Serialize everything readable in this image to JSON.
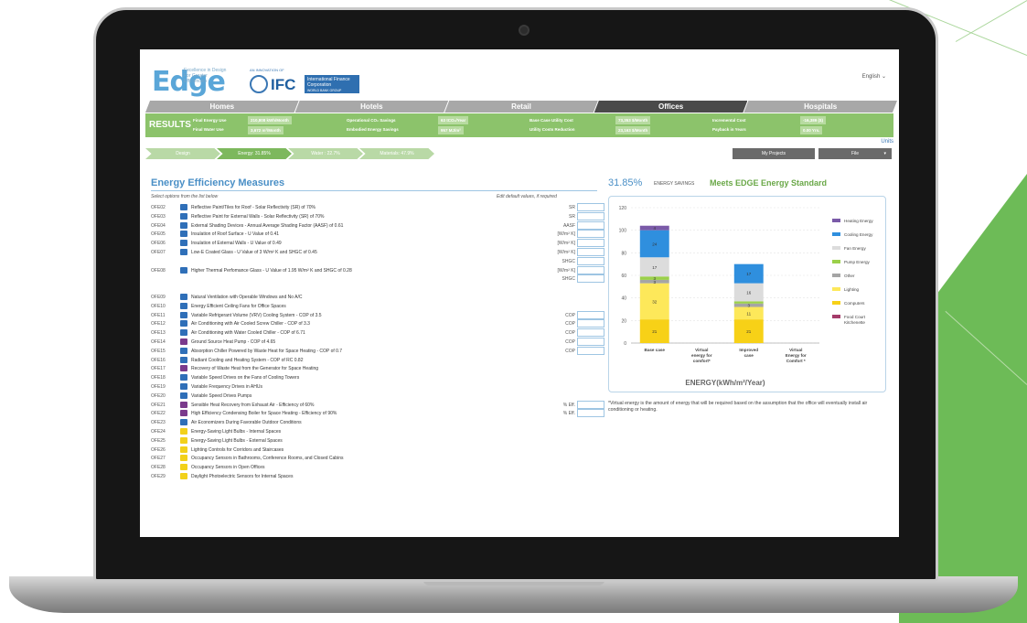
{
  "header": {
    "logo": "Edge",
    "logo_tagline": "Excellence in Design For Greater Efficiencies",
    "ifc_small": "AN INNOVATION OF",
    "ifc_logo": "IFC",
    "ifc_full": "International Finance Corporation",
    "ifc_group": "WORLD BANK GROUP",
    "language": "English"
  },
  "tabs": [
    {
      "label": "Homes",
      "active": false
    },
    {
      "label": "Hotels",
      "active": false
    },
    {
      "label": "Retail",
      "active": false
    },
    {
      "label": "Offices",
      "active": true
    },
    {
      "label": "Hospitals",
      "active": false
    }
  ],
  "results": {
    "title": "RESULTS",
    "final_energy_label": "Final Energy Use",
    "final_energy_value": "210,808 kWh/Month",
    "final_water_label": "Final Water Use",
    "final_water_value": "3,672 m³/Month",
    "op_co2_label": "Operational CO₂ Savings",
    "op_co2_value": "63 tCO₂/Year",
    "embodied_label": "Embodied Energy Savings",
    "embodied_value": "957 MJ/m²",
    "base_cost_label": "Base Case Utility Cost",
    "base_cost_value": "73,353 $/Month",
    "cost_red_label": "Utility Costs Reduction",
    "cost_red_value": "23,163 $/Month",
    "incr_cost_label": "Incremental Cost",
    "incr_cost_value": "-16,389 ($)",
    "payback_label": "Payback in Years",
    "payback_value": "0.00 Yrs."
  },
  "nav": {
    "steps": [
      {
        "label": "Design",
        "active": false
      },
      {
        "label": "Energy: 31.85%",
        "active": true
      },
      {
        "label": "Water : 22.7%",
        "active": false
      },
      {
        "label": "Materials: 47.9%",
        "active": false
      }
    ],
    "units_link": "Units",
    "my_projects": "My Projects",
    "file": "File"
  },
  "measures_panel": {
    "title": "Energy Efficiency Measures",
    "subtitle": "Select options from the list below",
    "edit_hint": "Edit default values, if required",
    "items": [
      {
        "code": "OFE02",
        "text": "Reflective Paint/Tiles for Roof - Solar Reflectivity (SR) of 70%",
        "unit": "SR",
        "color": "#2f6fb8",
        "input": true
      },
      {
        "code": "OFE03",
        "text": "Reflective Paint for External Walls - Solar Reflectivity (SR) of 70%",
        "unit": "SR",
        "color": "#2f6fb8",
        "input": true
      },
      {
        "code": "OFE04",
        "text": "External Shading Devices - Annual Average Shading Factor (AASF) of 0.61",
        "unit": "AASF",
        "color": "#2f6fb8",
        "input": true
      },
      {
        "code": "OFE05",
        "text": "Insulation of Roof Surface - U Value of 0.41",
        "unit": "[W/m² K]",
        "color": "#2f6fb8",
        "input": true
      },
      {
        "code": "OFE06",
        "text": "Insulation of External Walls - U Value of 0.49",
        "unit": "[W/m² K]",
        "color": "#2f6fb8",
        "input": true
      },
      {
        "code": "OFE07",
        "text": "Low-E Coated Glass - U Value of 3 W/m² K and SHGC of 0.45",
        "unit": "[W/m² K]",
        "color": "#2f6fb8",
        "input": true
      },
      {
        "code": "",
        "text": "",
        "unit": "SHGC",
        "color": "",
        "input": true
      },
      {
        "code": "OFE08",
        "text": "Higher Thermal Perfomance Glass - U Value of 1.95 W/m² K and SHGC of 0.28",
        "unit": "[W/m² K]",
        "color": "#2f6fb8",
        "input": true
      },
      {
        "code": "",
        "text": "",
        "unit": "SHGC",
        "color": "",
        "input": true
      },
      {
        "code": "",
        "text": "",
        "unit": "",
        "color": "",
        "input": false
      },
      {
        "code": "OFE09",
        "text": "Natural Ventilation with Operable Windows and No A/C",
        "unit": "",
        "color": "#2f6fb8",
        "input": false
      },
      {
        "code": "OFE10",
        "text": "Energy Efficient Ceiling Fans for Office Spaces",
        "unit": "",
        "color": "#2f6fb8",
        "input": false
      },
      {
        "code": "OFE11",
        "text": "Variable Refrigerant Volume (VRV) Cooling System - COP of 3.5",
        "unit": "COP",
        "color": "#2f6fb8",
        "input": true
      },
      {
        "code": "OFE12",
        "text": "Air Conditioning with Air Cooled Screw Chiller - COP of 3.3",
        "unit": "COP",
        "color": "#2f6fb8",
        "input": true
      },
      {
        "code": "OFE13",
        "text": "Air Conditioning with Water Cooled Chiller - COP of 6.71",
        "unit": "COP",
        "color": "#2f6fb8",
        "input": true
      },
      {
        "code": "OFE14",
        "text": "Ground Source Heat Pump - COP of 4.65",
        "unit": "COP",
        "color": "#7a3a8c",
        "input": true
      },
      {
        "code": "OFE15",
        "text": "Absorption Chiller Powered by Waste Heat for Space Heating - COP of 0.7",
        "unit": "COP",
        "color": "#2f6fb8",
        "input": true
      },
      {
        "code": "OFE16",
        "text": "Radiant Cooling and Heating System - COP of RC 0.82",
        "unit": "",
        "color": "#2f6fb8",
        "input": false
      },
      {
        "code": "OFE17",
        "text": "Recovery of Waste Heat from the Generator for Space Heating",
        "unit": "",
        "color": "#7a3a8c",
        "input": false
      },
      {
        "code": "OFE18",
        "text": "Variable Speed Drives on the Fans of Cooling Towers",
        "unit": "",
        "color": "#2f6fb8",
        "input": false
      },
      {
        "code": "OFE19",
        "text": "Variable Frequency Drives in AHUs",
        "unit": "",
        "color": "#2f6fb8",
        "input": false
      },
      {
        "code": "OFE20",
        "text": "Variable Speed Drives Pumps",
        "unit": "",
        "color": "#2f6fb8",
        "input": false
      },
      {
        "code": "OFE21",
        "text": "Sensible Heat Recovery from Exhaust Air - Efficiency of 60%",
        "unit": "% Eff.",
        "color": "#7a3a8c",
        "input": true
      },
      {
        "code": "OFE22",
        "text": "High Efficiency Condensing Boiler for Space Heating - Efficiency of 90%",
        "unit": "% Eff.",
        "color": "#7a3a8c",
        "input": true
      },
      {
        "code": "OFE23",
        "text": "Air Economizers During Favorable Outdoor Conditions",
        "unit": "",
        "color": "#2f6fb8",
        "input": false
      },
      {
        "code": "OFE24",
        "text": "Energy-Saving Light Bulbs - Internal Spaces",
        "unit": "",
        "color": "#f2d11a",
        "input": false
      },
      {
        "code": "OFE25",
        "text": "Energy-Saving Light Bulbs - External Spaces",
        "unit": "",
        "color": "#f2d11a",
        "input": false
      },
      {
        "code": "OFE26",
        "text": "Lighting Controls for Corridors and Staircases",
        "unit": "",
        "color": "#f2d11a",
        "input": false
      },
      {
        "code": "OFE27",
        "text": "Occupancy Sensors in Bathrooms, Conference Rooms, and Closed Cabins",
        "unit": "",
        "color": "#f2d11a",
        "input": false
      },
      {
        "code": "OFE28",
        "text": "Occupancy Sensors in Open Offices",
        "unit": "",
        "color": "#f2d11a",
        "input": false
      },
      {
        "code": "OFE29",
        "text": "Daylight Photoelectric Sensors for Internal Spaces",
        "unit": "",
        "color": "#f2d11a",
        "input": false
      }
    ]
  },
  "savings": {
    "percent": "31.85%",
    "label": "ENERGY SAVINGS",
    "standard": "Meets EDGE Energy Standard"
  },
  "chart_data": {
    "type": "bar",
    "stacked": true,
    "categories": [
      "Base case",
      "Virtual energy for comfort*",
      "Improved case",
      "Virtual Energy for Comfort *"
    ],
    "xlabel": "ENERGY(kWh/m²/Year)",
    "ylabel": "",
    "ylim": [
      0,
      120
    ],
    "yticks": [
      0,
      20,
      40,
      60,
      80,
      100,
      120
    ],
    "grid": true,
    "legend_position": "right",
    "series": [
      {
        "name": "Computers",
        "color": "#f7d117",
        "values": [
          21,
          0,
          21,
          0
        ]
      },
      {
        "name": "Lighting",
        "color": "#fde85a",
        "values": [
          32,
          0,
          11,
          0
        ]
      },
      {
        "name": "Other",
        "color": "#a5a5a5",
        "values": [
          3,
          0,
          3,
          0
        ]
      },
      {
        "name": "Pump Energy",
        "color": "#9bd04a",
        "values": [
          3,
          0,
          2,
          0
        ]
      },
      {
        "name": "Fan Energy",
        "color": "#dcdcdc",
        "values": [
          17,
          0,
          16,
          0
        ]
      },
      {
        "name": "Cooling Energy",
        "color": "#2f8fde",
        "values": [
          24,
          0,
          17,
          0
        ]
      },
      {
        "name": "Heating Energy",
        "color": "#7a5aa8",
        "values": [
          4,
          0,
          0,
          0
        ]
      },
      {
        "name": "Food Court Kitchenette",
        "color": "#a43c6a",
        "values": [
          0,
          0,
          0,
          0
        ]
      }
    ],
    "legend_order": [
      "Heating Energy",
      "Cooling Energy",
      "Fan Energy",
      "Pump Energy",
      "Other",
      "Lighting",
      "Computers",
      "Food Court Kitchenette"
    ]
  },
  "note": "*Virtual energy is the amount of energy that will be required based on the assumption that the office will eventually install air conditioning or heating."
}
